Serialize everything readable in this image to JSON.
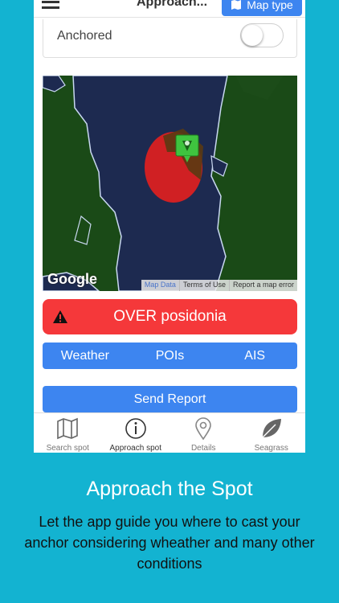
{
  "header": {
    "title": "Approach...",
    "map_type_label": "Map type"
  },
  "anchored": {
    "label": "Anchored",
    "enabled": false
  },
  "map": {
    "logo": "Google",
    "attribution": [
      "Map Data",
      "Terms of Use",
      "Report a map error"
    ]
  },
  "alert": {
    "text": "OVER posidonia",
    "color": "#f5383a"
  },
  "info_tabs": [
    "Weather",
    "POIs",
    "AIS"
  ],
  "send_report_label": "Send Report",
  "bottom_nav": [
    {
      "label": "Search spot",
      "icon": "map-icon"
    },
    {
      "label": "Approach spot",
      "icon": "info-icon"
    },
    {
      "label": "Details",
      "icon": "location-pin-icon"
    },
    {
      "label": "Seagrass",
      "icon": "leaf-icon"
    }
  ],
  "caption": {
    "title": "Approach the Spot",
    "body": "Let the app guide you where to cast your anchor considering wheather and many other conditions"
  },
  "colors": {
    "accent": "#3d85f0",
    "background": "#13b3d1"
  }
}
